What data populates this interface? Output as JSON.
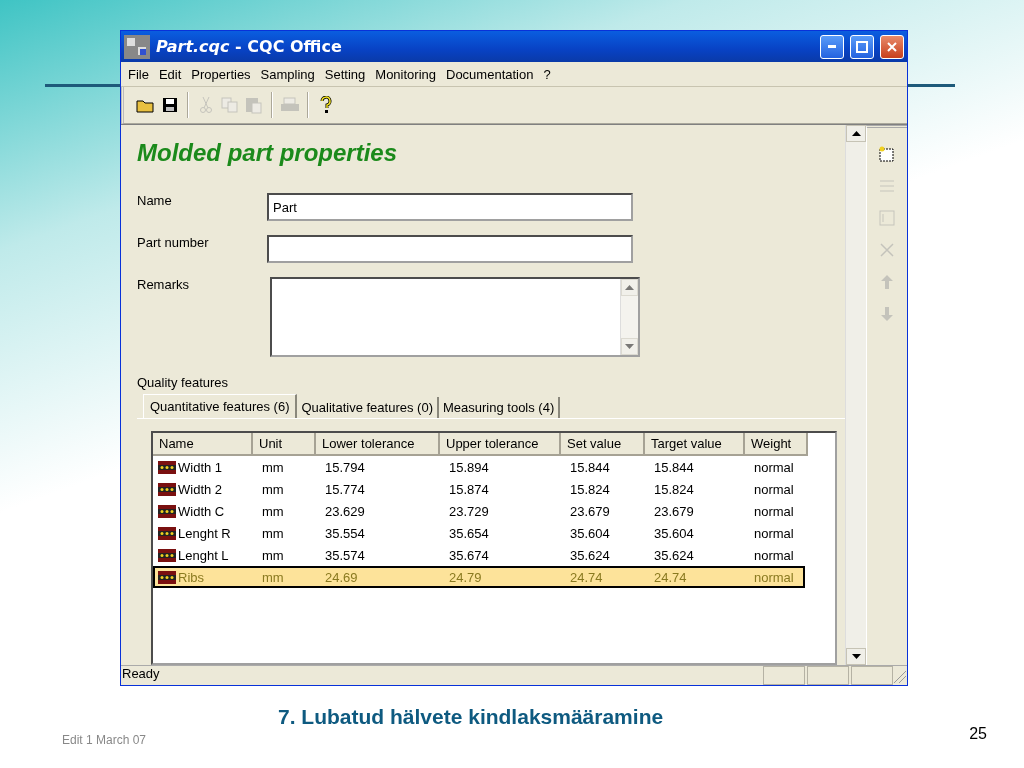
{
  "window": {
    "title": "*Part.cqc* - CQC Office"
  },
  "menu": [
    "File",
    "Edit",
    "Properties",
    "Sampling",
    "Setting",
    "Monitoring",
    "Documentation",
    "?"
  ],
  "toolbar": [
    {
      "kind": "open",
      "disabled": false
    },
    {
      "kind": "save",
      "disabled": false
    },
    {
      "kind": "sep"
    },
    {
      "kind": "cut",
      "disabled": true
    },
    {
      "kind": "copy",
      "disabled": true
    },
    {
      "kind": "paste",
      "disabled": true
    },
    {
      "kind": "sep"
    },
    {
      "kind": "print",
      "disabled": true
    },
    {
      "kind": "sep"
    },
    {
      "kind": "help",
      "disabled": false
    }
  ],
  "heading": "Molded part properties",
  "fields": [
    {
      "kind": "text",
      "label": "Name",
      "value": "Part"
    },
    {
      "kind": "text",
      "label": "Part number"
    },
    {
      "kind": "textarea",
      "label": "Remarks"
    }
  ],
  "quality_label": "Quality features",
  "tabs": [
    {
      "label": "Quantitative features (6)",
      "selected": true
    },
    {
      "label": "Qualitative features (0)",
      "selected": false
    },
    {
      "label": "Measuring tools (4)",
      "selected": false
    }
  ],
  "table": {
    "columns": [
      "Name",
      "Unit",
      "Lower tolerance",
      "Upper tolerance",
      "Set value",
      "Target value",
      "Weight"
    ],
    "rows": [
      {
        "cells": [
          "Width 1",
          "mm",
          "15.794",
          "15.894",
          "15.844",
          "15.844",
          "normal"
        ],
        "selected": false
      },
      {
        "cells": [
          "Width 2",
          "mm",
          "15.774",
          "15.874",
          "15.824",
          "15.824",
          "normal"
        ],
        "selected": false
      },
      {
        "cells": [
          "Width C",
          "mm",
          "23.629",
          "23.729",
          "23.679",
          "23.679",
          "normal"
        ],
        "selected": false
      },
      {
        "cells": [
          "Lenght R",
          "mm",
          "35.554",
          "35.654",
          "35.604",
          "35.604",
          "normal"
        ],
        "selected": false
      },
      {
        "cells": [
          "Lenght L",
          "mm",
          "35.574",
          "35.674",
          "35.624",
          "35.624",
          "normal"
        ],
        "selected": false
      },
      {
        "cells": [
          "Ribs",
          "mm",
          "24.69",
          "24.79",
          "24.74",
          "24.74",
          "normal"
        ],
        "selected": true
      }
    ]
  },
  "side_toolbar": [
    {
      "kind": "new",
      "disabled": false
    },
    {
      "kind": "lines",
      "disabled": true
    },
    {
      "kind": "form",
      "disabled": true
    },
    {
      "kind": "delete",
      "disabled": true
    },
    {
      "kind": "up",
      "disabled": true
    },
    {
      "kind": "down",
      "disabled": true
    }
  ],
  "status_bar": "Ready",
  "slide": {
    "caption": "7. Lubatud hälvete kindlaksmääramine",
    "footer": "Edit 1 March 07",
    "page_number": "25"
  }
}
